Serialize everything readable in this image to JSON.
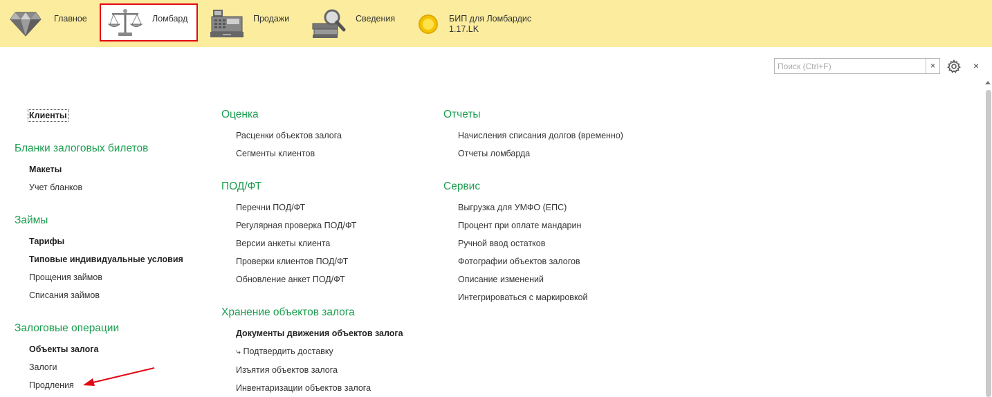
{
  "toolbar": {
    "sections": [
      {
        "label": "Главное",
        "icon": "diamond-icon"
      },
      {
        "label": "Ломбард",
        "icon": "scales-icon"
      },
      {
        "label": "Продажи",
        "icon": "cash-register-icon"
      },
      {
        "label": "Сведения",
        "icon": "magnifier-books-icon"
      },
      {
        "label": "БИП для Ломбардис",
        "label2": "1.17.LK",
        "icon": "yellow-circle-icon"
      }
    ],
    "active_index": 1
  },
  "search": {
    "placeholder": "Поиск (Ctrl+F)",
    "value": "",
    "clear_label": "×"
  },
  "window": {
    "close_label": "×"
  },
  "columns": [
    {
      "top_items": [
        {
          "label": "Клиенты",
          "bold": true
        }
      ],
      "groups": [
        {
          "title": "Бланки залоговых билетов",
          "items": [
            {
              "label": "Макеты",
              "bold": true
            },
            {
              "label": "Учет бланков"
            }
          ]
        },
        {
          "title": "Займы",
          "items": [
            {
              "label": "Тарифы",
              "bold": true
            },
            {
              "label": "Типовые индивидуальные условия",
              "bold": true
            },
            {
              "label": "Прощения займов"
            },
            {
              "label": "Списания займов"
            }
          ]
        },
        {
          "title": "Залоговые операции",
          "items": [
            {
              "label": "Объекты залога",
              "bold": true
            },
            {
              "label": "Залоги"
            },
            {
              "label": "Продления"
            }
          ]
        }
      ]
    },
    {
      "groups": [
        {
          "title": "Оценка",
          "items": [
            {
              "label": "Расценки объектов залога"
            },
            {
              "label": "Сегменты клиентов"
            }
          ]
        },
        {
          "title": "ПОД/ФТ",
          "items": [
            {
              "label": "Перечни ПОД/ФТ"
            },
            {
              "label": "Регулярная проверка ПОД/ФТ"
            },
            {
              "label": "Версии анкеты клиента"
            },
            {
              "label": "Проверки клиентов ПОД/ФТ"
            },
            {
              "label": "Обновление анкет ПОД/ФТ"
            }
          ]
        },
        {
          "title": "Хранение объектов залога",
          "items": [
            {
              "label": "Документы движения объектов залога",
              "bold": true
            },
            {
              "label": "⤷ Подтвердить доставку"
            },
            {
              "label": "Изъятия объектов залога"
            },
            {
              "label": "Инвентаризации объектов залога"
            }
          ]
        }
      ]
    },
    {
      "groups": [
        {
          "title": "Отчеты",
          "items": [
            {
              "label": "Начисления списания долгов (временно)"
            },
            {
              "label": "Отчеты ломбарда"
            }
          ]
        },
        {
          "title": "Сервис",
          "items": [
            {
              "label": "Выгрузка для УМФО (ЕПС)"
            },
            {
              "label": "Процент при оплате мандарин"
            },
            {
              "label": "Ручной ввод остатков"
            },
            {
              "label": "Фотографии объектов залогов"
            },
            {
              "label": "Описание изменений"
            },
            {
              "label": "Интегрироваться с маркировкой"
            }
          ]
        }
      ]
    }
  ],
  "colors": {
    "toolbar_bg": "#fbec9e",
    "group_title": "#1b9d4f",
    "highlight": "#e30613",
    "annotation_arrow": "#e30613"
  }
}
